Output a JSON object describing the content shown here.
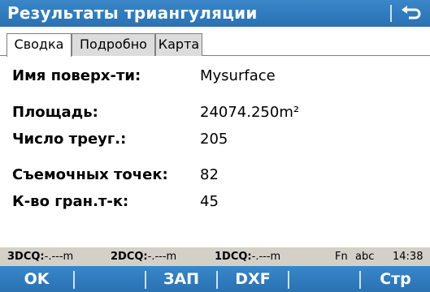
{
  "window": {
    "title": "Результаты триангуляции"
  },
  "tabs": [
    {
      "label": "Сводка"
    },
    {
      "label": "Подробно"
    },
    {
      "label": "Карта"
    }
  ],
  "summary": {
    "surface_name": {
      "label": "Имя поверх-ти:",
      "value": "Mysurface"
    },
    "area": {
      "label": "Площадь:",
      "value": "24074.250m²"
    },
    "triangles": {
      "label": "Число треуг.:",
      "value": "205"
    },
    "survey_points": {
      "label": "Съемочных точек:",
      "value": "82"
    },
    "boundary_points": {
      "label": "К-во гран.т-к:",
      "value": "45"
    }
  },
  "status_bar": {
    "dcq3_label": "3DCQ:",
    "dcq3_value": "-.---m",
    "dcq2_label": "2DCQ:",
    "dcq2_value": "-.---m",
    "dcq1_label": "1DCQ:",
    "dcq1_value": "-.---m",
    "fn": "Fn",
    "input_mode": "abc",
    "time": "14:38"
  },
  "softkeys": {
    "f1": "OK",
    "f2": "",
    "f3": "ЗАП",
    "f4": "DXF",
    "f5": "",
    "f6": "Стр"
  },
  "colors": {
    "bar_blue": "#2f7bbd",
    "status_gray": "#d4d0c8"
  },
  "icons": {
    "back": "back-arrow-icon"
  }
}
